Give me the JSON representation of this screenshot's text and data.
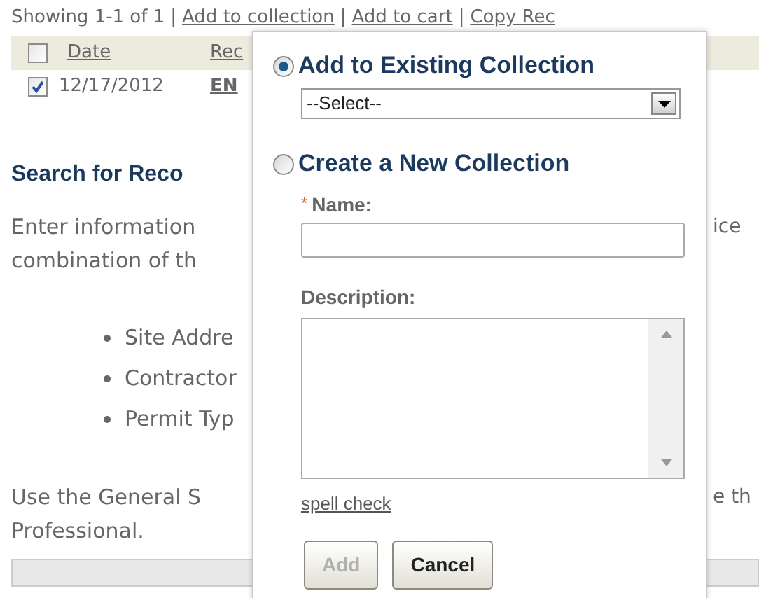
{
  "toolbar": {
    "summary": "Showing 1-1 of 1",
    "separator": "|",
    "links": [
      "Add to collection",
      "Add to cart",
      "Copy Rec"
    ]
  },
  "table": {
    "header": {
      "checked": false,
      "columns": [
        "Date",
        "Rec"
      ]
    },
    "rows": [
      {
        "checked": true,
        "cells": [
          "12/17/2012",
          "EN"
        ]
      }
    ]
  },
  "section": {
    "title": "Search for Reco",
    "intro": [
      {
        "left": "Enter information",
        "right": "ice"
      },
      {
        "left": "combination of th"
      }
    ],
    "bullets": [
      "Site Addre",
      "Contractor",
      "Permit Typ"
    ],
    "outro": [
      {
        "left": "Use the General S",
        "right": "e th"
      },
      {
        "left": "Professional."
      }
    ]
  },
  "popup": {
    "options": [
      {
        "kind": "existing",
        "label": "Add to Existing Collection",
        "selected": true,
        "select_value": "--Select--"
      },
      {
        "kind": "new",
        "label": "Create a New Collection",
        "selected": false,
        "required_mark": "*",
        "name_label": "Name:",
        "description_label": "Description:",
        "spell_check": "spell check"
      }
    ],
    "buttons": [
      {
        "label": "Add",
        "disabled": true
      },
      {
        "label": "Cancel",
        "disabled": false
      }
    ]
  }
}
